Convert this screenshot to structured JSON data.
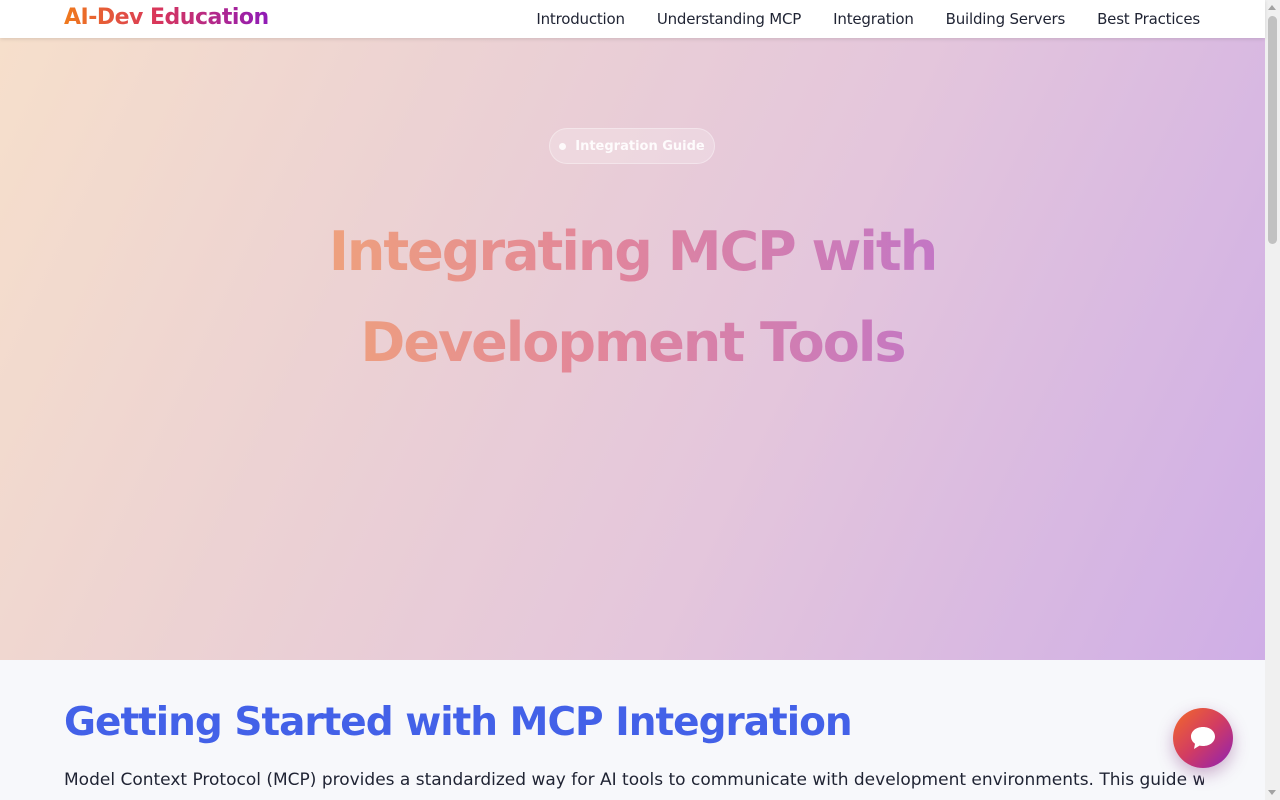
{
  "header": {
    "logo": "AI-Dev Education",
    "nav": [
      {
        "label": "Introduction"
      },
      {
        "label": "Understanding MCP"
      },
      {
        "label": "Integration"
      },
      {
        "label": "Building Servers"
      },
      {
        "label": "Best Practices"
      }
    ]
  },
  "hero": {
    "badge": "Integration Guide",
    "title_line1": "Integrating MCP with",
    "title_line2": "Development Tools",
    "subtitle": ""
  },
  "section": {
    "title": "Getting Started with MCP Integration",
    "text": "Model Context Protocol (MCP) provides a standardized way for AI tools to communicate with development environments. This guide will"
  },
  "chat_button": {
    "icon": "chat-bubble-icon"
  },
  "colors": {
    "accent": "#4361e8",
    "logo_start": "#f07a1c",
    "logo_end": "#8f1bb8",
    "hero_start": "#f6dfcb",
    "hero_end": "#cfaee6"
  }
}
